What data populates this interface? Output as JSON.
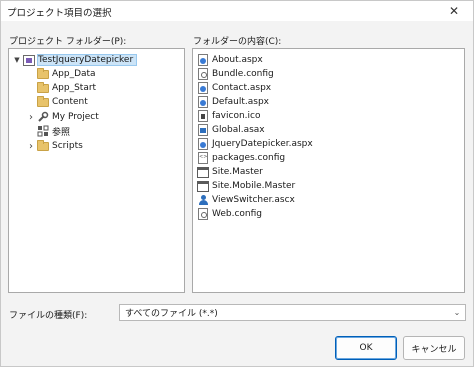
{
  "dialog": {
    "title": "プロジェクト項目の選択",
    "close_glyph": "✕"
  },
  "left_pane": {
    "label": "プロジェクト フォルダー(P):",
    "tree": [
      {
        "label": "TestJqueryDatepicker",
        "icon": "project-icon",
        "expander": "▼",
        "selected": true
      },
      {
        "label": "App_Data",
        "icon": "folder-icon",
        "expander": ""
      },
      {
        "label": "App_Start",
        "icon": "folder-icon",
        "expander": ""
      },
      {
        "label": "Content",
        "icon": "folder-icon",
        "expander": ""
      },
      {
        "label": "My Project",
        "icon": "wrench-icon",
        "expander": "›"
      },
      {
        "label": "参照",
        "icon": "references-icon",
        "expander": ""
      },
      {
        "label": "Scripts",
        "icon": "folder-icon",
        "expander": "›"
      }
    ]
  },
  "right_pane": {
    "label": "フォルダーの内容(C):",
    "files": [
      {
        "label": "About.aspx",
        "icon": "web-page-icon"
      },
      {
        "label": "Bundle.config",
        "icon": "config-file-icon"
      },
      {
        "label": "Contact.aspx",
        "icon": "web-page-icon"
      },
      {
        "label": "Default.aspx",
        "icon": "web-page-icon"
      },
      {
        "label": "favicon.ico",
        "icon": "image-file-icon"
      },
      {
        "label": "Global.asax",
        "icon": "global-asax-icon"
      },
      {
        "label": "JqueryDatepicker.aspx",
        "icon": "web-page-icon"
      },
      {
        "label": "packages.config",
        "icon": "xml-file-icon"
      },
      {
        "label": "Site.Master",
        "icon": "master-page-icon"
      },
      {
        "label": "Site.Mobile.Master",
        "icon": "master-page-icon"
      },
      {
        "label": "ViewSwitcher.ascx",
        "icon": "user-control-icon"
      },
      {
        "label": "Web.config",
        "icon": "config-file-icon"
      }
    ]
  },
  "file_type": {
    "label": "ファイルの種類(F):",
    "value": "すべてのファイル (*.*)",
    "arrow": "⌄"
  },
  "buttons": {
    "ok": "OK",
    "cancel": "キャンセル"
  }
}
